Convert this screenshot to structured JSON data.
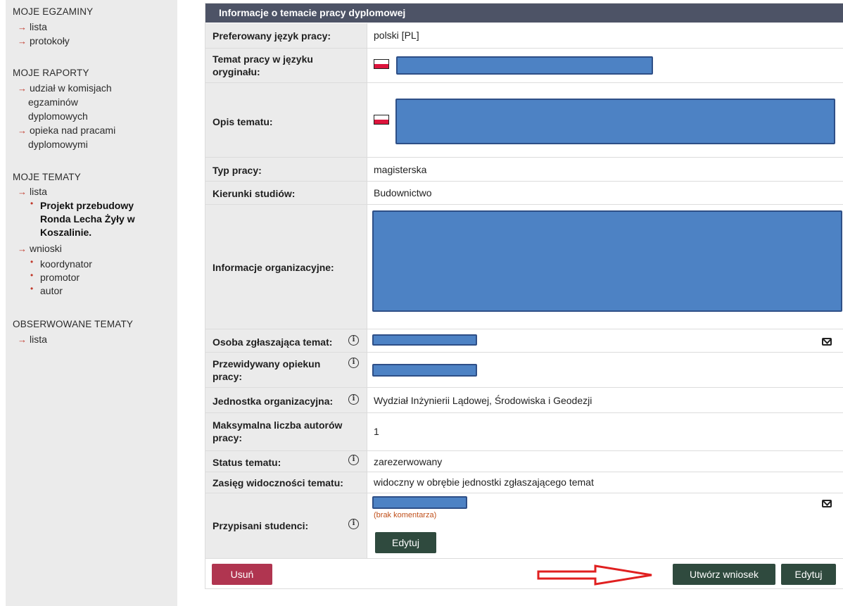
{
  "sidebar": {
    "egzaminy": {
      "title": "MOJE EGZAMINY",
      "items": [
        "lista",
        "protokoły"
      ]
    },
    "raporty": {
      "title": "MOJE RAPORTY",
      "items": [
        {
          "lines": [
            "udział w komisjach",
            "egzaminów",
            "dyplomowych"
          ]
        },
        {
          "lines": [
            "opieka nad pracami",
            "dyplomowymi"
          ]
        }
      ]
    },
    "tematy": {
      "title": "MOJE TEMATY",
      "lista": "lista",
      "current": [
        "Projekt przebudowy",
        "Ronda Lecha Żyły w",
        "Koszalinie."
      ],
      "wnioski": "wnioski",
      "wnioski_items": [
        "koordynator",
        "promotor",
        "autor"
      ]
    },
    "obserwowane": {
      "title": "OBSERWOWANE TEMATY",
      "items": [
        "lista"
      ]
    }
  },
  "panel": {
    "header": "Informacje o temacie pracy dyplomowej",
    "rows": {
      "jezyk": {
        "label": "Preferowany język pracy:",
        "value": "polski [PL]"
      },
      "temat": {
        "label_lines": [
          "Temat pracy w języku",
          "oryginału:"
        ]
      },
      "opis": {
        "label": "Opis tematu:"
      },
      "typ": {
        "label": "Typ pracy:",
        "value": "magisterska"
      },
      "kierunki": {
        "label": "Kierunki studiów:",
        "value": "Budownictwo"
      },
      "info_org": {
        "label": "Informacje organizacyjne:"
      },
      "osoba": {
        "label": "Osoba zgłaszająca temat:"
      },
      "opiekun": {
        "label_lines": [
          "Przewidywany opiekun",
          "pracy:"
        ]
      },
      "jednostka": {
        "label": "Jednostka organizacyjna:",
        "value": "Wydział Inżynierii Lądowej, Środowiska i Geodezji"
      },
      "maks": {
        "label_lines": [
          "Maksymalna liczba autorów",
          "pracy:"
        ],
        "value": "1"
      },
      "status": {
        "label": "Status tematu:",
        "value": "zarezerwowany"
      },
      "zasieg": {
        "label": "Zasięg widoczności tematu:",
        "value": "widoczny w obrębie jednostki zgłaszającego temat"
      },
      "studenci": {
        "label": "Przypisani studenci:",
        "comment": "(brak komentarza)",
        "edit_button": "Edytuj"
      }
    },
    "footer": {
      "delete_button": "Usuń",
      "create_request_button": "Utwórz wniosek",
      "edit_button": "Edytuj"
    }
  },
  "icons": {
    "nav_arrow": "arrow-right-icon",
    "info": "info-icon",
    "mail": "mail-icon",
    "flag": "flag-pl-icon"
  },
  "colors": {
    "header_bg": "#4d5366",
    "label_bg": "#ebebeb",
    "btn_dark": "#2f4a3e",
    "btn_red": "#b03550",
    "arrow": "#c0392b",
    "redaction": "#4d82c4",
    "annotation_arrow": "#e02020"
  }
}
